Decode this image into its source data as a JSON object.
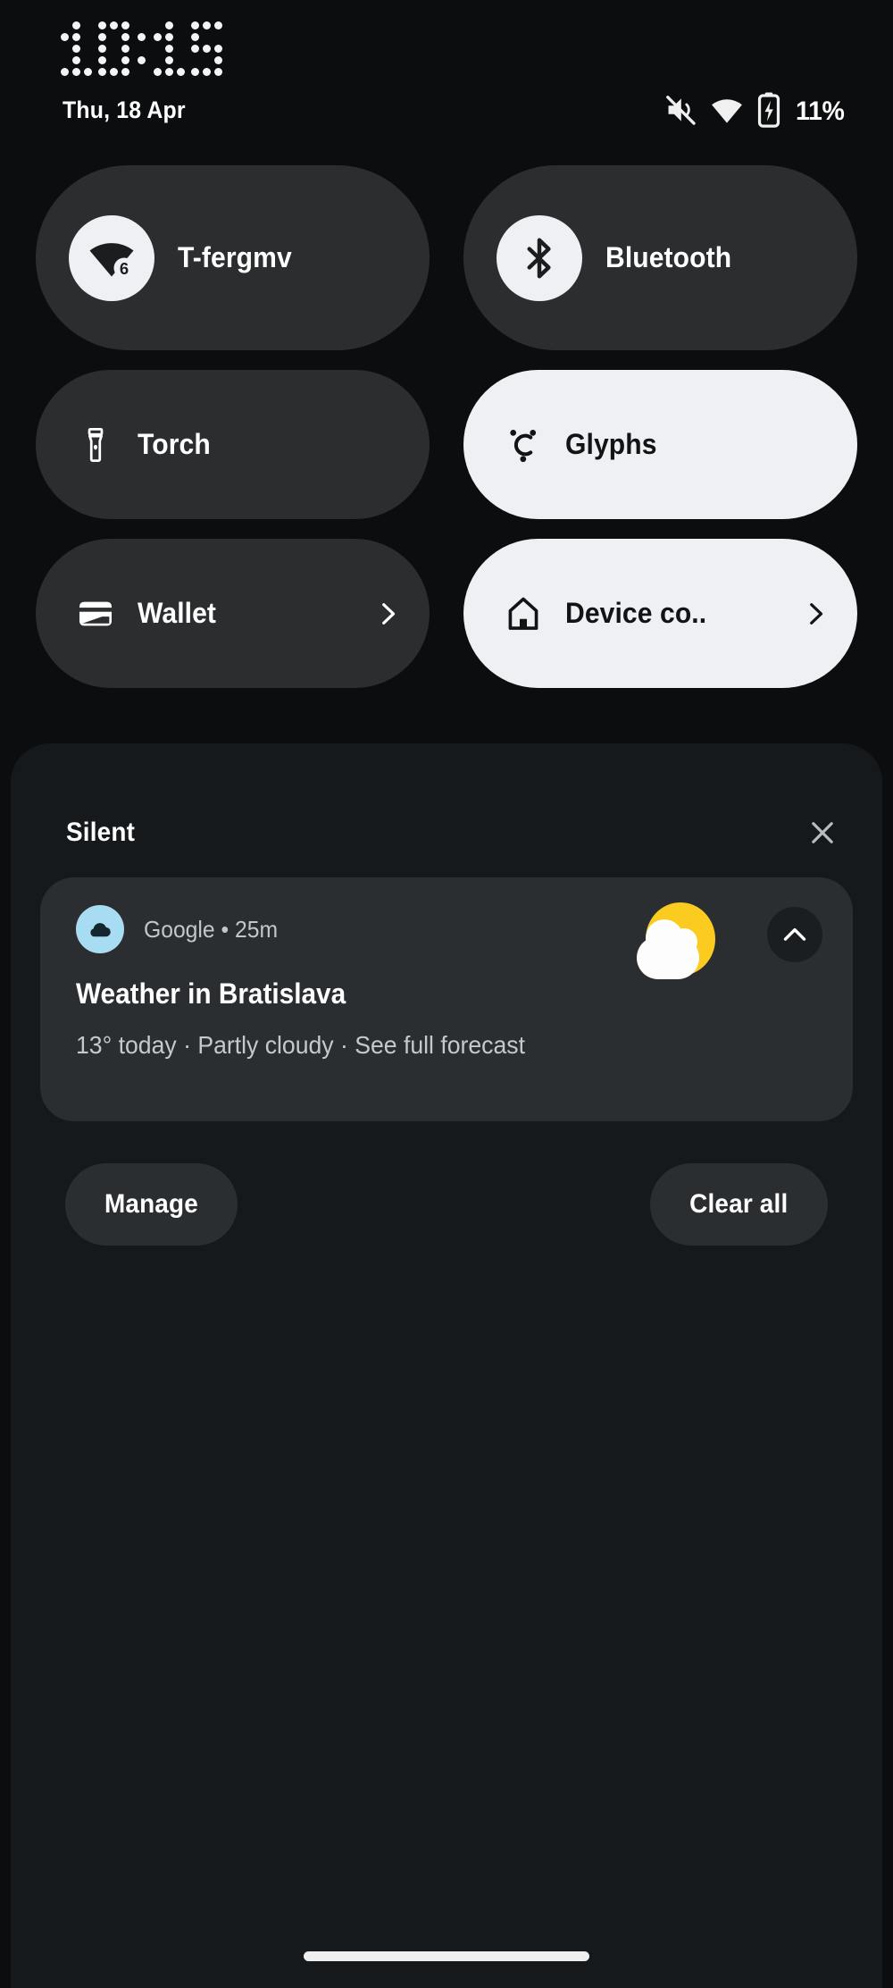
{
  "statusbar": {
    "time": "10:15",
    "time_digits": [
      "1",
      "0",
      ":",
      "1",
      "5"
    ],
    "date": "Thu, 18 Apr",
    "battery_percent": "11%",
    "icons": [
      "volume-mute-icon",
      "wifi-icon",
      "battery-charging-icon"
    ]
  },
  "quick_settings": {
    "tiles": [
      {
        "label": "T-fergmv",
        "icon": "wifi-6-icon",
        "state": "on",
        "style": "dark-circle-icon",
        "badge": "6"
      },
      {
        "label": "Bluetooth",
        "icon": "bluetooth-icon",
        "state": "on",
        "style": "dark-circle-icon"
      },
      {
        "label": "Torch",
        "icon": "flashlight-icon",
        "state": "off",
        "style": "dark-plain-icon"
      },
      {
        "label": "Glyphs",
        "icon": "glyph-icon",
        "state": "on",
        "style": "light-plain-icon"
      },
      {
        "label": "Wallet",
        "icon": "wallet-icon",
        "state": "off",
        "style": "dark-plain-icon",
        "chevron": "chevron-right-icon"
      },
      {
        "label": "Device co..",
        "icon": "home-icon",
        "state": "on",
        "style": "light-plain-icon",
        "chevron": "chevron-right-icon"
      }
    ]
  },
  "notification_panel": {
    "section_title": "Silent",
    "close_icon": "close-icon",
    "notification": {
      "app_name": "Google",
      "separator": "•",
      "time_ago": "25m",
      "meta_line": "Google • 25m",
      "title": "Weather in Bratislava",
      "body": "13° today · Partly cloudy · See full forecast",
      "app_icon": "cloud-icon",
      "weather_icon": "partly-cloudy-icon",
      "expand_icon": "chevron-up-icon"
    },
    "actions": {
      "manage_label": "Manage",
      "clear_all_label": "Clear all"
    }
  },
  "navigation": {
    "home_indicator": "home-gesture-bar"
  },
  "colors": {
    "background": "#0c0d0e",
    "panel": "#16191c",
    "tile_inactive": "#2b2d2f",
    "tile_active": "#eef0f4",
    "text_primary": "#ffffff",
    "text_secondary": "#c5c9cd",
    "sun_yellow": "#fbcb20",
    "app_icon_blue": "#a8dcf2"
  }
}
